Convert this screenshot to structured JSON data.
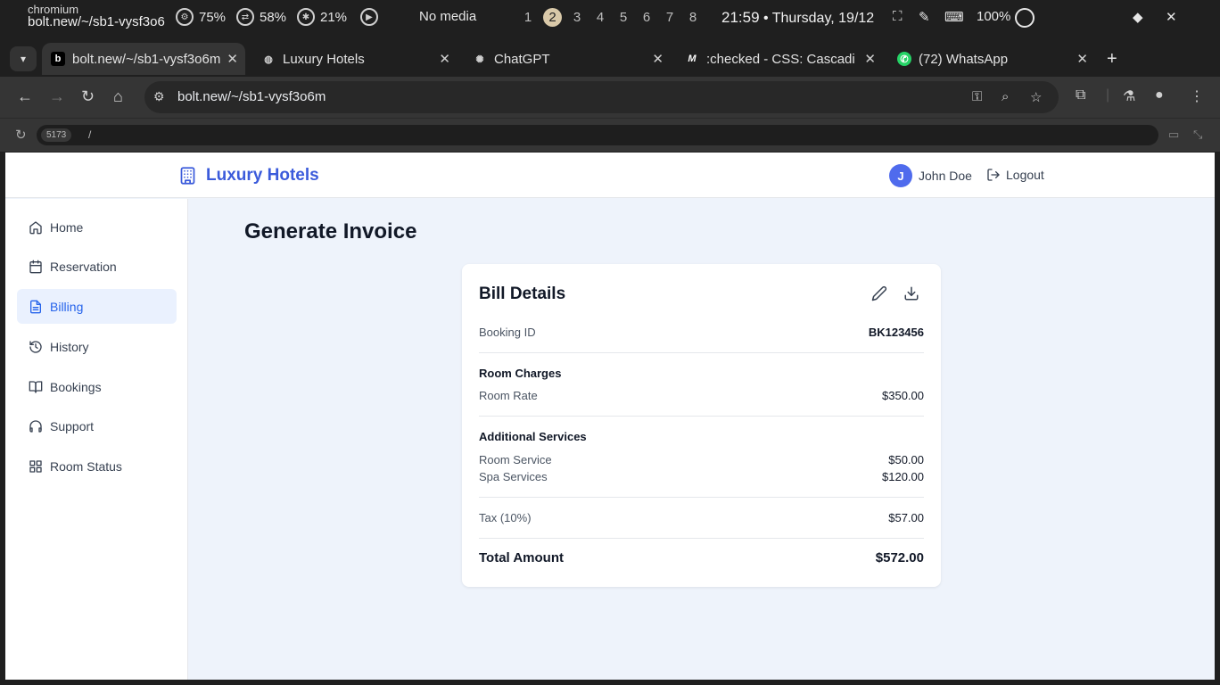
{
  "system": {
    "app_name": "chromium",
    "window_title": "bolt.new/~/sb1-vysf3o6",
    "cpu": "75%",
    "mem": "58%",
    "temp": "21%",
    "media": "No media",
    "workspaces": [
      "1",
      "2",
      "3",
      "4",
      "5",
      "6",
      "7",
      "8"
    ],
    "active_workspace": "2",
    "time": "21:59",
    "date": "• Thursday, 19/12",
    "battery": "100%"
  },
  "browser": {
    "tabs": [
      {
        "title": "bolt.new/~/sb1-vysf3o6m",
        "favicon": "bolt-icon",
        "active": true
      },
      {
        "title": "Luxury Hotels",
        "favicon": "globe-icon",
        "active": false
      },
      {
        "title": "ChatGPT",
        "favicon": "chatgpt-icon",
        "active": false
      },
      {
        "title": ":checked - CSS: Cascadi",
        "favicon": "mdn-icon",
        "active": false
      },
      {
        "title": "(72) WhatsApp",
        "favicon": "whatsapp-icon",
        "active": false
      }
    ],
    "url": "bolt.new/~/sb1-vysf3o6m",
    "dev_port": "5173",
    "dev_path": "/"
  },
  "app": {
    "brand": "Luxury Hotels",
    "user": {
      "initial": "J",
      "name": "John Doe"
    },
    "logout_label": "Logout",
    "sidebar": [
      {
        "label": "Home",
        "icon": "home-icon"
      },
      {
        "label": "Reservation",
        "icon": "calendar-icon"
      },
      {
        "label": "Billing",
        "icon": "file-text-icon",
        "active": true
      },
      {
        "label": "History",
        "icon": "history-icon"
      },
      {
        "label": "Bookings",
        "icon": "book-open-icon"
      },
      {
        "label": "Support",
        "icon": "headphones-icon"
      },
      {
        "label": "Room Status",
        "icon": "grid-icon"
      }
    ],
    "page_title": "Generate Invoice",
    "bill": {
      "title": "Bill Details",
      "booking_label": "Booking ID",
      "booking_id": "BK123456",
      "room_charges_heading": "Room Charges",
      "room_rate_label": "Room Rate",
      "room_rate": "$350.00",
      "services_heading": "Additional Services",
      "room_service_label": "Room Service",
      "room_service": "$50.00",
      "spa_label": "Spa Services",
      "spa": "$120.00",
      "tax_label": "Tax (10%)",
      "tax": "$57.00",
      "total_label": "Total Amount",
      "total": "$572.00"
    }
  }
}
